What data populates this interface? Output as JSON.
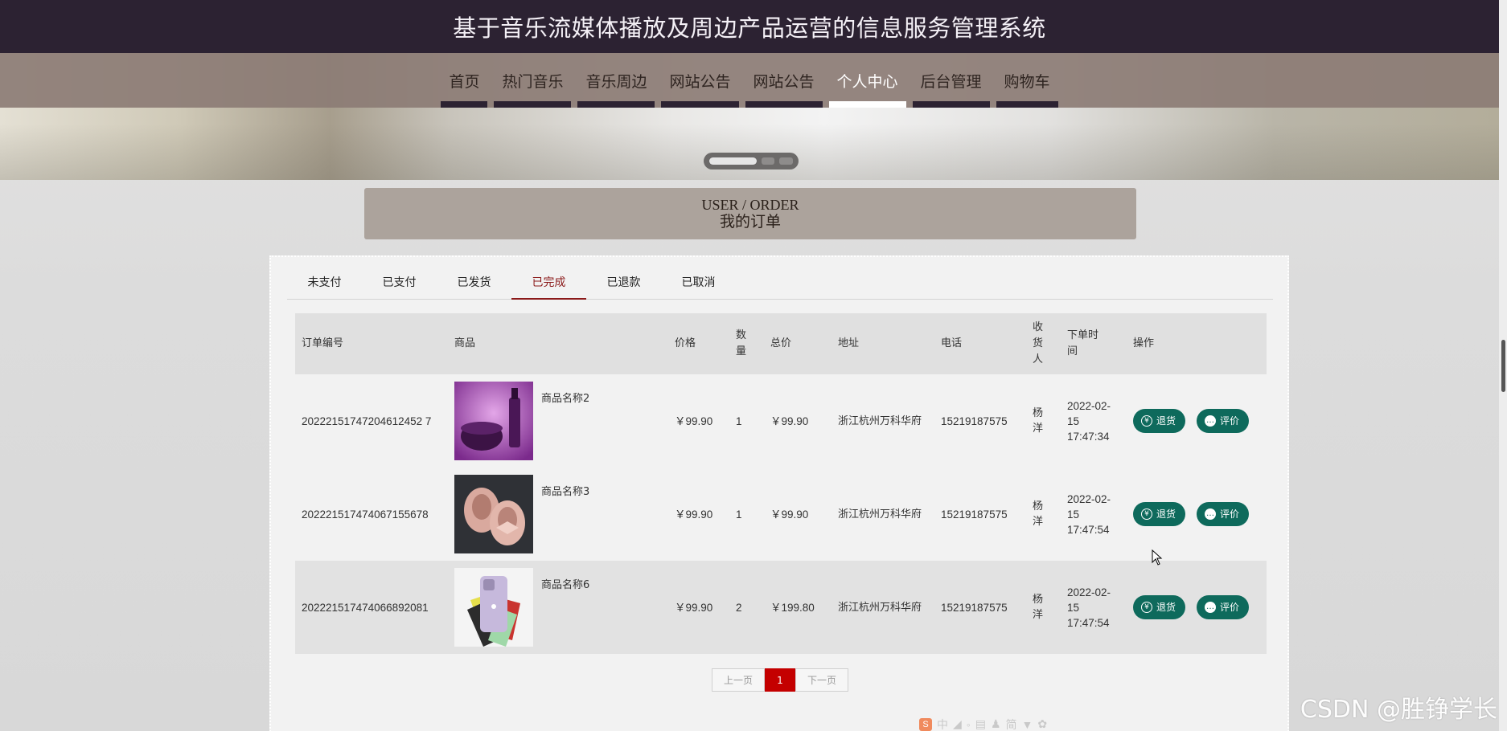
{
  "header": {
    "site_title": "基于音乐流媒体播放及周边产品运营的信息服务管理系统"
  },
  "nav": {
    "items": [
      {
        "label": "首页",
        "active": false
      },
      {
        "label": "热门音乐",
        "active": false
      },
      {
        "label": "音乐周边",
        "active": false
      },
      {
        "label": "网站公告",
        "active": false
      },
      {
        "label": "网站公告",
        "active": false
      },
      {
        "label": "个人中心",
        "active": true
      },
      {
        "label": "后台管理",
        "active": false
      },
      {
        "label": "购物车",
        "active": false
      }
    ]
  },
  "banner": {
    "slides": 3,
    "active_slide": 1
  },
  "page_heading": {
    "en": "USER / ORDER",
    "cn": "我的订单"
  },
  "tabs": [
    {
      "label": "未支付",
      "active": false
    },
    {
      "label": "已支付",
      "active": false
    },
    {
      "label": "已发货",
      "active": false
    },
    {
      "label": "已完成",
      "active": true
    },
    {
      "label": "已退款",
      "active": false
    },
    {
      "label": "已取消",
      "active": false
    }
  ],
  "table": {
    "headers": {
      "order_no": "订单编号",
      "goods": "商品",
      "price": "价格",
      "qty": "数量",
      "total": "总价",
      "address": "地址",
      "phone": "电话",
      "receiver": "收货人",
      "order_time": "下单时间",
      "actions": "操作"
    },
    "rows": [
      {
        "order_no": "20222151747204612452 7",
        "goods_name": "商品名称2",
        "image": "cosmetics-product-image",
        "price": "￥99.90",
        "qty": "1",
        "total": "￥99.90",
        "address": "浙江杭州万科华府",
        "phone": "15219187575",
        "receiver": "杨洋",
        "order_time": "2022-02-15 17:47:34"
      },
      {
        "order_no": "202221517474067155678",
        "goods_name": "商品名称3",
        "image": "shoes-product-image",
        "price": "￥99.90",
        "qty": "1",
        "total": "￥99.90",
        "address": "浙江杭州万科华府",
        "phone": "15219187575",
        "receiver": "杨洋",
        "order_time": "2022-02-15 17:47:54"
      },
      {
        "order_no": "202221517474066892081",
        "goods_name": "商品名称6",
        "image": "phone-product-image",
        "price": "￥99.90",
        "qty": "2",
        "total": "￥199.80",
        "address": "浙江杭州万科华府",
        "phone": "15219187575",
        "receiver": "杨洋",
        "order_time": "2022-02-15 17:47:54"
      }
    ],
    "refund_label": "退货",
    "review_label": "评价"
  },
  "pagination": {
    "prev": "上一页",
    "current": "1",
    "next": "下一页"
  },
  "watermark": "CSDN @胜铮学长",
  "colors": {
    "top_bar": "#2c2232",
    "nav_bar": "#8c7c75",
    "accent_red": "#8b1a1a",
    "action_button": "#0e6a5c",
    "page_active": "#c40000"
  }
}
